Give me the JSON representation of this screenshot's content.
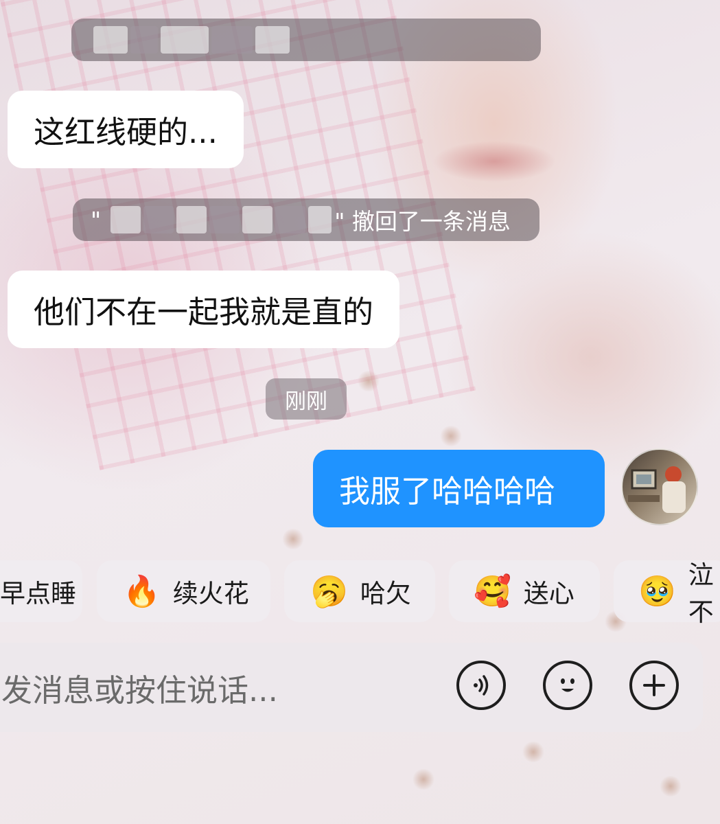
{
  "chat": {
    "top_banner": "",
    "messages": [
      {
        "side": "in",
        "text": "这红线硬的..."
      },
      {
        "side": "system",
        "text_prefix": "\"",
        "text_suffix": "\" 撤回了一条消息"
      },
      {
        "side": "in",
        "text": "他们不在一起我就是直的"
      },
      {
        "side": "time",
        "text": "刚刚"
      },
      {
        "side": "out",
        "text": "我服了哈哈哈哈"
      }
    ]
  },
  "quick_replies": [
    {
      "label": "早点睡",
      "visible_label": "早点睡",
      "icon": "moon-icon"
    },
    {
      "label": "续火花",
      "icon": "fire-icon",
      "emoji": "🔥"
    },
    {
      "label": "哈欠",
      "icon": "yawn-face-icon",
      "emoji": "🥱"
    },
    {
      "label": "送心",
      "icon": "heart-hug-face-icon",
      "emoji": "🥰"
    },
    {
      "label": "泣不",
      "icon": "teary-face-icon",
      "emoji": "🥹"
    }
  ],
  "input": {
    "placeholder": "发消息或按住说话..."
  },
  "icons": {
    "voice": "voice-wave-icon",
    "emoji": "emoji-face-icon",
    "plus": "plus-circle-icon"
  },
  "colors": {
    "outgoing_bubble": "#1f93ff",
    "incoming_bubble": "#ffffff"
  }
}
